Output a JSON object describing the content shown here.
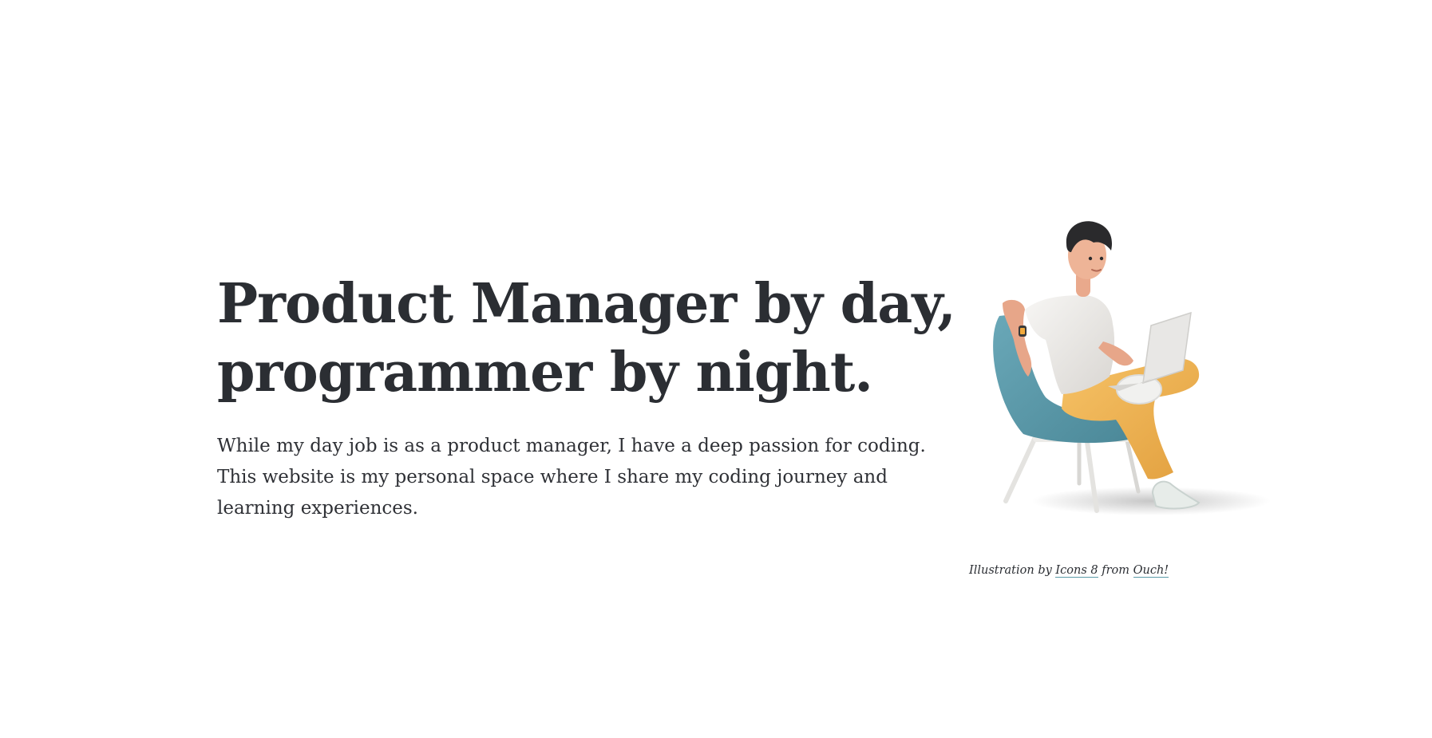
{
  "hero": {
    "headline_line1": "Product Manager by day,",
    "headline_line2": "programmer by night.",
    "lead": "While my day job is as a product manager, I have a deep passion for coding. This website is my personal space where I share my coding journey and learning experiences."
  },
  "illustration": {
    "icon": "person-on-chair-with-laptop-illustration",
    "caption_prefix": "Illustration by ",
    "caption_link1": "Icons 8",
    "caption_middle": " from ",
    "caption_link2": "Ouch!"
  },
  "colors": {
    "text": "#2b2e33",
    "link_underline": "#5a9aa8",
    "chair": "#5f9cad",
    "pants": "#efb24f",
    "shirt": "#eeecea"
  }
}
